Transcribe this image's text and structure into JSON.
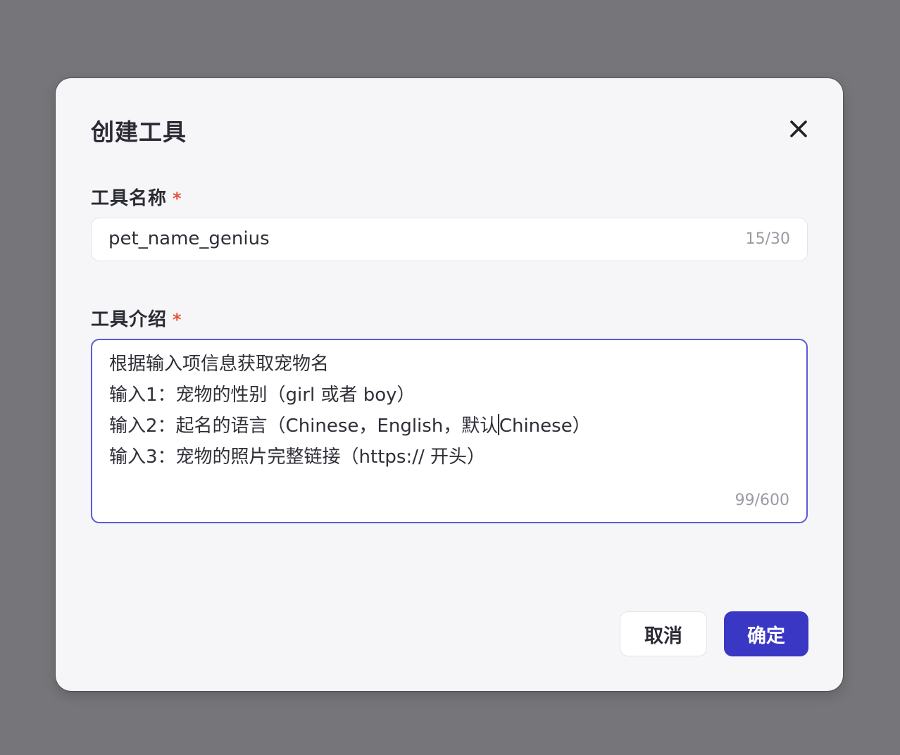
{
  "dialog": {
    "title": "创建工具",
    "close_icon": "close-icon"
  },
  "name_field": {
    "label": "工具名称",
    "required_mark": "*",
    "value": "pet_name_genius",
    "counter": "15/30"
  },
  "description_field": {
    "label": "工具介绍",
    "required_mark": "*",
    "lines": [
      "根据输入项信息获取宠物名",
      "输入1：宠物的性别（girl 或者 boy）",
      "输入2：起名的语言（Chinese，English，默认",
      "输入3：宠物的照片完整链接（https:// 开头）"
    ],
    "line3_after_caret": "Chinese）",
    "counter": "99/600",
    "focused": true
  },
  "footer": {
    "cancel_label": "取消",
    "ok_label": "确定"
  },
  "colors": {
    "primary": "#3a37c4",
    "focus_border": "#5b5bd8",
    "required": "#e5533d",
    "overlay": "#76767a"
  }
}
